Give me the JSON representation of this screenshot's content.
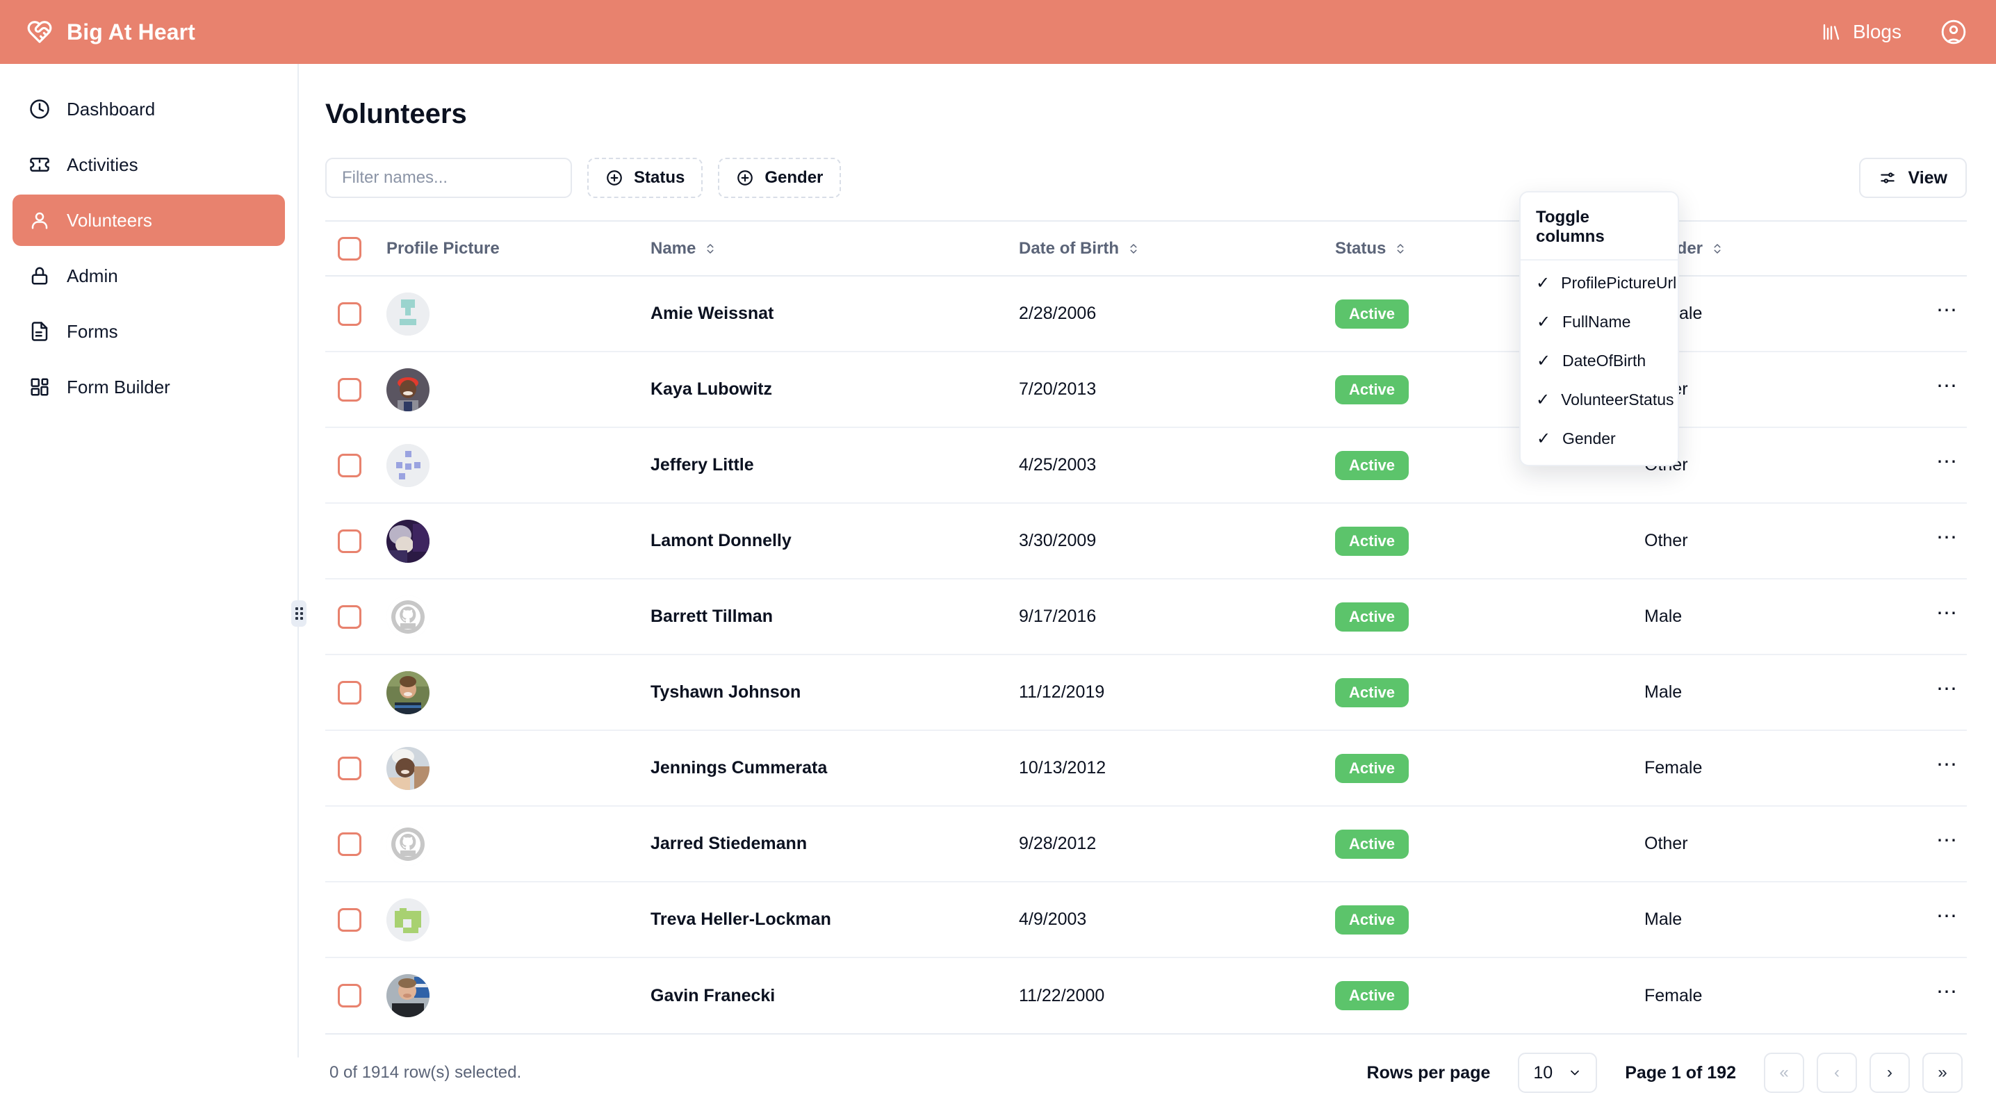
{
  "brand": {
    "name": "Big At Heart",
    "icon": "heart-handshake-icon",
    "color": "#e8826e"
  },
  "topbar": {
    "blogs_label": "Blogs",
    "blogs_icon": "library-books-icon",
    "account_icon": "user-circle-icon"
  },
  "sidebar": {
    "items": [
      {
        "label": "Dashboard",
        "icon": "clock-icon",
        "active": false
      },
      {
        "label": "Activities",
        "icon": "ticket-icon",
        "active": false
      },
      {
        "label": "Volunteers",
        "icon": "user-icon",
        "active": true
      },
      {
        "label": "Admin",
        "icon": "lock-icon",
        "active": false
      },
      {
        "label": "Forms",
        "icon": "file-text-icon",
        "active": false
      },
      {
        "label": "Form Builder",
        "icon": "layout-blocks-icon",
        "active": false
      }
    ],
    "resize_handle_icon": "grip-dots-icon"
  },
  "page": {
    "title": "Volunteers"
  },
  "toolbar": {
    "filter_placeholder": "Filter names...",
    "filter_value": "",
    "facets": [
      {
        "label": "Status",
        "icon": "plus-circle-icon"
      },
      {
        "label": "Gender",
        "icon": "plus-circle-icon"
      }
    ],
    "view_label": "View",
    "view_icon": "sliders-icon"
  },
  "view_dropdown": {
    "title": "Toggle columns",
    "items": [
      {
        "label": "ProfilePictureUrl",
        "checked": true
      },
      {
        "label": "FullName",
        "checked": true
      },
      {
        "label": "DateOfBirth",
        "checked": true
      },
      {
        "label": "VolunteerStatus",
        "checked": true
      },
      {
        "label": "Gender",
        "checked": true
      }
    ],
    "check_icon": "check-icon"
  },
  "table": {
    "select_all_checked": false,
    "columns": [
      {
        "label": "Profile Picture",
        "sortable": false
      },
      {
        "label": "Name",
        "sortable": true
      },
      {
        "label": "Date of Birth",
        "sortable": true
      },
      {
        "label": "Status",
        "sortable": true
      },
      {
        "label": "Gender",
        "sortable": true
      }
    ],
    "sort_icon": "chevron-up-down-icon",
    "row_action_icon": "ellipsis-icon",
    "rows": [
      {
        "name": "Amie Weissnat",
        "dob": "2/28/2006",
        "status": "Active",
        "gender": "Female",
        "avatar": "placeholder-teal"
      },
      {
        "name": "Kaya Lubowitz",
        "dob": "7/20/2013",
        "status": "Active",
        "gender": "Other",
        "avatar": "photo-red-cap"
      },
      {
        "name": "Jeffery Little",
        "dob": "4/25/2003",
        "status": "Active",
        "gender": "Other",
        "avatar": "placeholder-periwinkle"
      },
      {
        "name": "Lamont Donnelly",
        "dob": "3/30/2009",
        "status": "Active",
        "gender": "Other",
        "avatar": "photo-purple"
      },
      {
        "name": "Barrett Tillman",
        "dob": "9/17/2016",
        "status": "Active",
        "gender": "Male",
        "avatar": "github-octocat"
      },
      {
        "name": "Tyshawn Johnson",
        "dob": "11/12/2019",
        "status": "Active",
        "gender": "Male",
        "avatar": "photo-outdoor"
      },
      {
        "name": "Jennings Cummerata",
        "dob": "10/13/2012",
        "status": "Active",
        "gender": "Female",
        "avatar": "photo-white-cap"
      },
      {
        "name": "Jarred Stiedemann",
        "dob": "9/28/2012",
        "status": "Active",
        "gender": "Other",
        "avatar": "github-octocat"
      },
      {
        "name": "Treva Heller-Lockman",
        "dob": "4/9/2003",
        "status": "Active",
        "gender": "Male",
        "avatar": "placeholder-green"
      },
      {
        "name": "Gavin Franecki",
        "dob": "11/22/2000",
        "status": "Active",
        "gender": "Female",
        "avatar": "photo-store"
      }
    ]
  },
  "footer": {
    "selection_text": "0 of 1914 row(s) selected.",
    "rows_per_page_label": "Rows per page",
    "rows_per_page_value": "10",
    "page_label": "Page 1 of 192",
    "nav": [
      {
        "name": "first-page",
        "glyph": "«"
      },
      {
        "name": "prev-page",
        "glyph": "‹"
      },
      {
        "name": "next-page",
        "glyph": "›"
      },
      {
        "name": "last-page",
        "glyph": "»"
      }
    ]
  },
  "colors": {
    "brand": "#e8826e",
    "badge_active": "#5cc46b",
    "checkbox_border": "#e8826e"
  }
}
